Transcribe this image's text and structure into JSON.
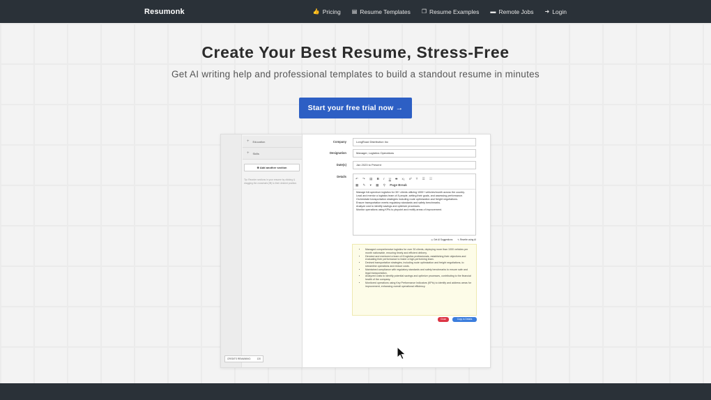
{
  "nav": {
    "brand": "Resumonk",
    "links": [
      {
        "label": "Pricing",
        "icon": "thumbs-up-icon"
      },
      {
        "label": "Resume Templates",
        "icon": "document-icon"
      },
      {
        "label": "Resume Examples",
        "icon": "copy-icon"
      },
      {
        "label": "Remote Jobs",
        "icon": "briefcase-icon"
      },
      {
        "label": "Login",
        "icon": "login-icon"
      }
    ]
  },
  "hero": {
    "title": "Create Your Best Resume, Stress-Free",
    "subtitle": "Get AI writing help and professional templates to build a standout resume in minutes",
    "cta": "Start your free trial now →"
  },
  "app": {
    "sections": [
      "Education",
      "Skills"
    ],
    "add_section": "⊕ Add another section",
    "tip": "Tip: Reorder sections in your resume by clicking & dragging the crosshairs (✥) to their desired position.",
    "credits_label": "CREDITS REMAINING:",
    "credits_value": "120",
    "fields": [
      {
        "label": "Company",
        "value": "LongRoad Distribution Inc"
      },
      {
        "label": "Designation",
        "value": "Manager, Logistics Operations"
      },
      {
        "label": "Date(s)",
        "value": "Jan 2023 to Present"
      }
    ],
    "details_label": "Details",
    "toolbar_page_break": "Page Break",
    "details_text": [
      "Manage full-spectrum logistics for 30+ clients utilizing 1000+ vehicles/month across the country.",
      "Lead and mentor a logistics team of 8 people, setting their goals, and assessing performance.",
      "Orchestrate transportation strategies including route optimization and freight negotiations.",
      "Ensure transportation meets regulatory standards and safety benchmarks.",
      "Analyze cost to identify savings and optimize processes.",
      "Monitor operations using KPIs to pinpoint and rectify areas of improvement."
    ],
    "ai_suggestions": "Get AI Suggestions",
    "ai_rewrite": "Rewrite using AI",
    "suggestions": [
      "Managed comprehensive logistics for over 30 clients, deploying more than 1000 vehicles per month nationwide, ensuring timely and efficient delivery.",
      "Directed and mentored a team of 8 logistics professionals, establishing their objectives and evaluating their performance to foster a high-performing team.",
      "Devised transportation strategies, including route optimization and freight negotiations, to streamline operations and reduce costs.",
      "Maintained compliance with regulatory standards and safety benchmarks to ensure safe and legal transportation.",
      "Analyzed costs to identify potential savings and optimize processes, contributing to the financial health of the company.",
      "Monitored operations using Key Performance Indicators (KPIs) to identify and address areas for improvement, enhancing overall operational efficiency."
    ],
    "close_label": "Close",
    "copy_label": "Copy to Details"
  }
}
